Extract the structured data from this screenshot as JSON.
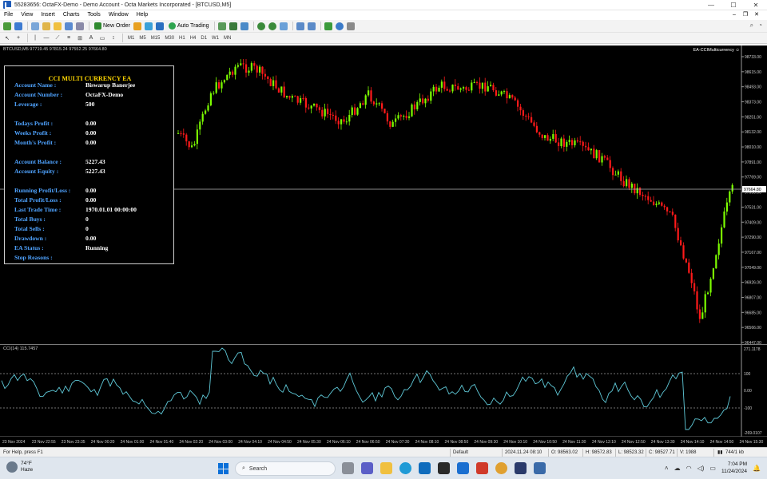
{
  "window": {
    "title": "55283656: OctaFX-Demo - Demo Account - Octa Markets Incorporated - [BTCUSD,M5]",
    "controls": [
      "—",
      "☐",
      "✕"
    ]
  },
  "menu": {
    "items": [
      "File",
      "View",
      "Insert",
      "Charts",
      "Tools",
      "Window",
      "Help"
    ]
  },
  "toolbar": {
    "new_order": "New Order",
    "auto_trading": "Auto Trading",
    "timeframes": [
      "M1",
      "M5",
      "M15",
      "M30",
      "H1",
      "H4",
      "D1",
      "W1",
      "MN"
    ]
  },
  "chart": {
    "symbol_line": "BTCUSD,M5  97719.45 97815.24 97552.25 97664.80",
    "ea_name": "EA-CCIMulticurrency ☺",
    "current_price": "97664.80",
    "price_ticks": [
      "98733.00",
      "98615.00",
      "98493.00",
      "98373.00",
      "98251.00",
      "98132.00",
      "98010.00",
      "97891.00",
      "97769.00",
      "97650.00",
      "97531.00",
      "97409.00",
      "97290.00",
      "97167.00",
      "97049.00",
      "96926.00",
      "96807.00",
      "96685.00",
      "96566.00",
      "96447.00"
    ],
    "cci_label": "CCI(14) 115.7457",
    "cci_ticks": [
      "271.1178",
      "100",
      "0.00",
      "-100",
      "-269.0107"
    ],
    "time_labels": [
      "23 Nov 2024",
      "23 Nov 22:55",
      "23 Nov 23:35",
      "24 Nov 00:20",
      "24 Nov 01:00",
      "24 Nov 01:40",
      "24 Nov 02:20",
      "24 Nov 03:00",
      "24 Nov 04:10",
      "24 Nov 04:50",
      "24 Nov 05:30",
      "24 Nov 06:10",
      "24 Nov 06:50",
      "24 Nov 07:30",
      "24 Nov 08:10",
      "24 Nov 08:50",
      "24 Nov 09:30",
      "24 Nov 10:10",
      "24 Nov 10:50",
      "24 Nov 11:30",
      "24 Nov 12:10",
      "24 Nov 12:50",
      "24 Nov 13:30",
      "24 Nov 14:10",
      "24 Nov 14:50",
      "24 Nov 15:30"
    ],
    "colors": {
      "bull": "#7cfc00",
      "bear": "#ff1a1a",
      "cci": "#5fc9d8",
      "background": "#000000"
    }
  },
  "ea_panel": {
    "title": "CCI MULTI CURRENCY EA",
    "rows": [
      {
        "label": "Account Name :",
        "value": "Biswarup Banerjee"
      },
      {
        "label": "Account Number :",
        "value": "OctaFX-Demo"
      },
      {
        "label": "Leverage :",
        "value": "500"
      },
      {
        "label": "Todays Profit :",
        "value": "0.00"
      },
      {
        "label": "Weeks Profit :",
        "value": "0.00"
      },
      {
        "label": "Month's Profit :",
        "value": "0.00"
      },
      {
        "label": "Account Balance :",
        "value": "5227.43"
      },
      {
        "label": "Account Equity :",
        "value": "5227.43"
      },
      {
        "label": "Running Profit/Loss :",
        "value": "0.00"
      },
      {
        "label": "Total Profit/Loss :",
        "value": "0.00"
      },
      {
        "label": "Last Trade Time :",
        "value": "1970.01.01 00:00:00"
      },
      {
        "label": "Total Buys :",
        "value": "0"
      },
      {
        "label": "Total Sells :",
        "value": "0"
      },
      {
        "label": "Drawdown :",
        "value": "0.00"
      },
      {
        "label": "EA Status :",
        "value": "Running"
      },
      {
        "label": "Stop Reasons :",
        "value": ""
      }
    ]
  },
  "status": {
    "help": "For Help, press F1",
    "profile": "Default",
    "datetime": "2024.11.24 08:10",
    "open": "O: 98563.02",
    "high": "H: 98572.83",
    "low": "L: 98523.32",
    "close": "C: 98527.71",
    "volume": "V: 1988",
    "traffic": "744/1 kb"
  },
  "taskbar": {
    "temperature": "74°F",
    "weather": "Haze",
    "search_placeholder": "Search",
    "time": "7:04 PM",
    "date": "11/24/2024"
  }
}
